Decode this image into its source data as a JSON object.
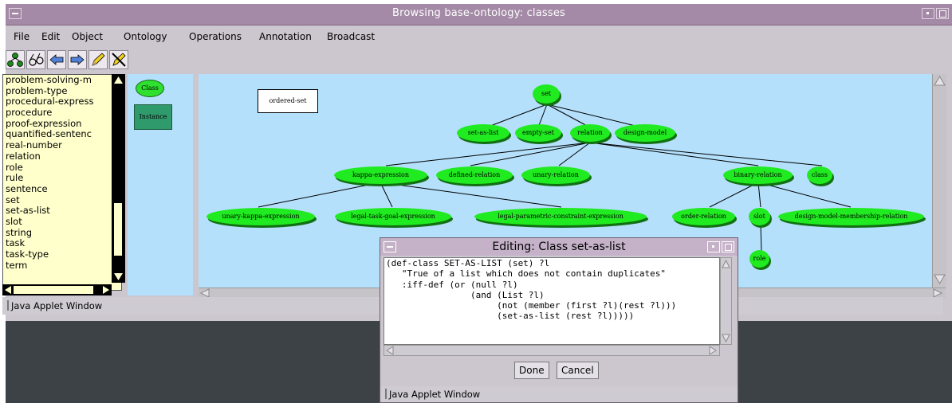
{
  "window": {
    "title": "Browsing base-ontology: classes"
  },
  "menu": [
    "File",
    "Edit",
    "Object",
    "Ontology",
    "Operations",
    "Annotation",
    "Broadcast"
  ],
  "toolbar_icons": [
    "tree-icon",
    "glasses-icon",
    "arrow-left-icon",
    "arrow-right-icon",
    "pencil-icon",
    "pencil-delete-icon"
  ],
  "class_list": [
    "problem-solving-m",
    "problem-type",
    "procedural-express",
    "procedure",
    "proof-expression",
    "quantified-sentenc",
    "real-number",
    "relation",
    "role",
    "rule",
    "sentence",
    "set",
    "set-as-list",
    "slot",
    "string",
    "task",
    "task-type",
    "term"
  ],
  "mode_panel": {
    "class_label": "Class",
    "instance_label": "Instance"
  },
  "graph": {
    "nodes": {
      "ordered_set": "ordered-set",
      "set": "set",
      "set_as_list": "set-as-list",
      "empty_set": "empty-set",
      "relation": "relation",
      "design_model": "design-model",
      "kappa_expression": "kappa-expression",
      "defined_relation": "defined-relation",
      "unary_relation": "unary-relation",
      "binary_relation": "binary-relation",
      "class": "class",
      "unary_kappa_expression": "unary-kappa-expression",
      "legal_task_goal_expression": "legal-task-goal-expression",
      "legal_parametric_constraint_expression": "legal-parametric-constraint-expression",
      "order_relation": "order-relation",
      "slot": "slot",
      "design_model_membership_relation": "design-model-membership-relation",
      "role": "role"
    }
  },
  "status": {
    "applet_label": "Java Applet Window"
  },
  "dialog": {
    "title": "Editing: Class set-as-list",
    "code_lines": [
      "(def-class SET-AS-LIST (set) ?l",
      "   \"True of a list which does not contain duplicates\"",
      "   :iff-def (or (null ?l)",
      "                (and (List ?l)",
      "                     (not (member (first ?l)(rest ?l)))",
      "                     (set-as-list (rest ?l)))))"
    ],
    "done_label": "Done",
    "cancel_label": "Cancel",
    "applet_label": "Java Applet Window"
  }
}
